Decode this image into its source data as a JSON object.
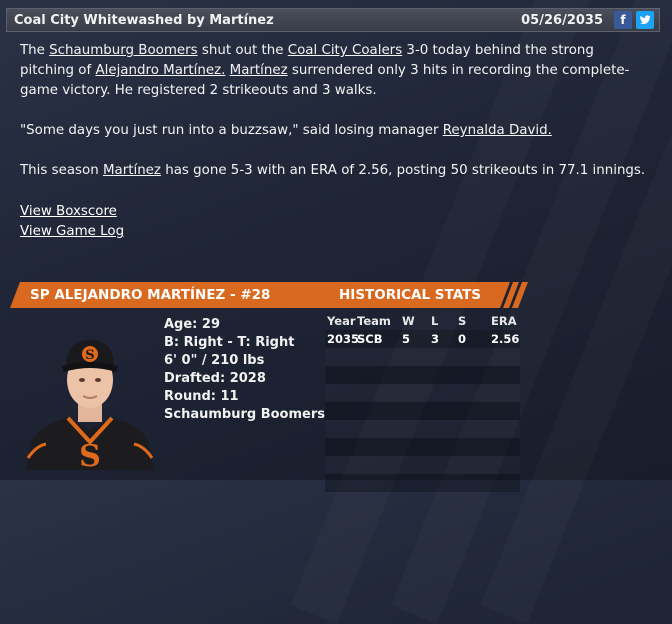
{
  "header": {
    "title": "Coal City Whitewashed by Martínez",
    "date": "05/26/2035",
    "facebook_icon": "f",
    "twitter_icon": "t"
  },
  "article": {
    "p1": {
      "t1": "The ",
      "team1": "Schaumburg Boomers",
      "t2": " shut out the ",
      "team2": "Coal City Coalers",
      "t3": " 3-0 today behind the strong pitching of ",
      "pitcher": "Alejandro Martínez.",
      "t4": " ",
      "pitcher2": "Martínez",
      "t5": " surrendered only 3 hits in recording the complete-game victory. He registered 2 strikeouts and 3 walks."
    },
    "p2": {
      "t1": "\"Some days you just run into a buzzsaw,\" said losing manager ",
      "manager": "Reynalda David."
    },
    "p3": {
      "t1": "This season ",
      "pitcher": "Martínez",
      "t2": " has gone 5-3 with an ERA of 2.56, posting 50 strikeouts in 77.1 innings."
    }
  },
  "links": {
    "boxscore": "View Boxscore",
    "gamelog": "View Game Log"
  },
  "player": {
    "banner_name": "SP ALEJANDRO MARTÍNEZ - #28",
    "banner_stats": "HISTORICAL STATS",
    "age": "Age: 29",
    "bats_throws": "B: Right - T: Right",
    "height_weight": "6' 0\" / 210 lbs",
    "drafted": "Drafted: 2028",
    "round": "Round: 11",
    "team": "Schaumburg Boomers"
  },
  "stats": {
    "headers": {
      "year": "Year",
      "team": "Team",
      "w": "W",
      "l": "L",
      "s": "S",
      "era": "ERA"
    },
    "rows": [
      {
        "year": "2035",
        "team": "SCB",
        "w": "5",
        "l": "3",
        "s": "0",
        "era": "2.56"
      }
    ]
  },
  "colors": {
    "accent_orange": "#d9691e",
    "background": "#1f2536",
    "title_bar": "#42464f"
  }
}
